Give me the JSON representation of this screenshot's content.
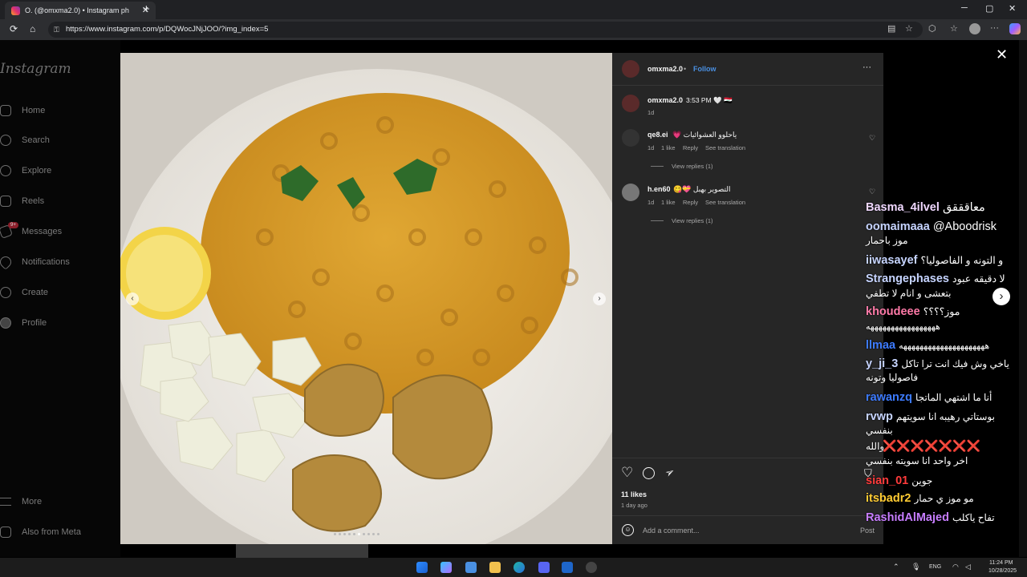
{
  "browser": {
    "tab_title": "O. (@omxma2.0) • Instagram ph",
    "tab_close": "✕",
    "new_tab": "+",
    "url": "https://www.instagram.com/p/DQWocJNjJOO/?img_index=5",
    "win_min": "─",
    "win_max": "▢",
    "win_close": "✕"
  },
  "sidebar": {
    "logo": "Instagram",
    "items": [
      {
        "label": "Home"
      },
      {
        "label": "Search"
      },
      {
        "label": "Explore"
      },
      {
        "label": "Reels"
      },
      {
        "label": "Messages",
        "badge": "9+"
      },
      {
        "label": "Notifications"
      },
      {
        "label": "Create"
      },
      {
        "label": "Profile"
      },
      {
        "label": "More"
      },
      {
        "label": "Also from Meta"
      }
    ]
  },
  "viewer": {
    "close": "✕",
    "prev": "‹",
    "next": "›",
    "next_outer": "›"
  },
  "post": {
    "author": "omxma2.0",
    "dot": "•",
    "follow": "Follow",
    "more": "···",
    "caption_user": "omxma2.0",
    "caption_text": "3:53 PM 🤍 🇮🇶",
    "caption_age": "1d",
    "likes": "11 likes",
    "date": "1 day ago",
    "add_comment": "Add a comment...",
    "post_btn": "Post"
  },
  "comments": [
    {
      "user": "qe8.ei",
      "text": "💗 ياحلوو العشوائيات",
      "age": "1d",
      "likes": "1 like",
      "reply": "Reply",
      "translate": "See translation",
      "view_replies": "View replies (1)"
    },
    {
      "user": "h.en60",
      "text": "😋💝 التصوير بهبل",
      "age": "1d",
      "likes": "1 like",
      "reply": "Reply",
      "translate": "See translation",
      "view_replies": "View replies (1)"
    }
  ],
  "chat": [
    {
      "user": "Basma_4ilvel",
      "msg": "معاقققق",
      "color": "#f0d8ff"
    },
    {
      "user": "oomaimaaa",
      "msg": "@Aboodrisk",
      "color": "#c6d4ff"
    },
    {
      "user": "",
      "msg": "موز باحمار",
      "color": "#ffffff"
    },
    {
      "user": "iiwasayef",
      "msg": "و التونه و الفاصوليا؟",
      "color": "#c6d4ff"
    },
    {
      "user": "Strangephases",
      "msg": "لا دقيقه عبود",
      "color": "#c6d4ff"
    },
    {
      "user": "",
      "msg": "بتعشى و انام لا تطفي",
      "color": "#ffffff"
    },
    {
      "user": "khoudeee",
      "msg": "موز؟؟؟؟",
      "color": "#ff7aa8"
    },
    {
      "user": "",
      "msg": "هههههههههههههههههه",
      "color": "#ffffff"
    },
    {
      "user": "llmaa",
      "msg": "هههههههههههههههههههههه",
      "color": "#3d7bff"
    },
    {
      "user": "y_ji_3",
      "msg": "ياخي وش فيك انت ترا تاكل",
      "color": "#c6d4ff"
    },
    {
      "user": "",
      "msg": "فاصوليا وتونه",
      "color": "#ffffff"
    },
    {
      "user": "rawanzq",
      "msg": "أنا ما اشتهي الماتجا",
      "color": "#3d7bff"
    },
    {
      "user": "rvwp",
      "msg": "بوستاتي رهيبه انا سويتهم",
      "color": "#c6d4ff"
    },
    {
      "user": "",
      "msg": "بنفسي",
      "color": "#ffffff"
    },
    {
      "user": "",
      "msg": "والله",
      "color": "#ffffff"
    },
    {
      "user": "",
      "msg": "❌❌❌❌❌❌❌",
      "color": "#ffffff"
    },
    {
      "user": "",
      "msg": "اخر واحد انا سويته بنفسي",
      "color": "#ffffff"
    },
    {
      "user": "sian_01",
      "msg": "جوين",
      "color": "#ff3b3b"
    },
    {
      "user": "itsbadr2",
      "msg": "مو موز ي حمار",
      "color": "#ffcc33"
    },
    {
      "user": "RashidAlMajed",
      "msg": "تفاح ياكلب",
      "color": "#c77dff"
    }
  ],
  "taskbar": {
    "lang": "ENG",
    "time": "11:24 PM",
    "date": "10/28/2025"
  }
}
